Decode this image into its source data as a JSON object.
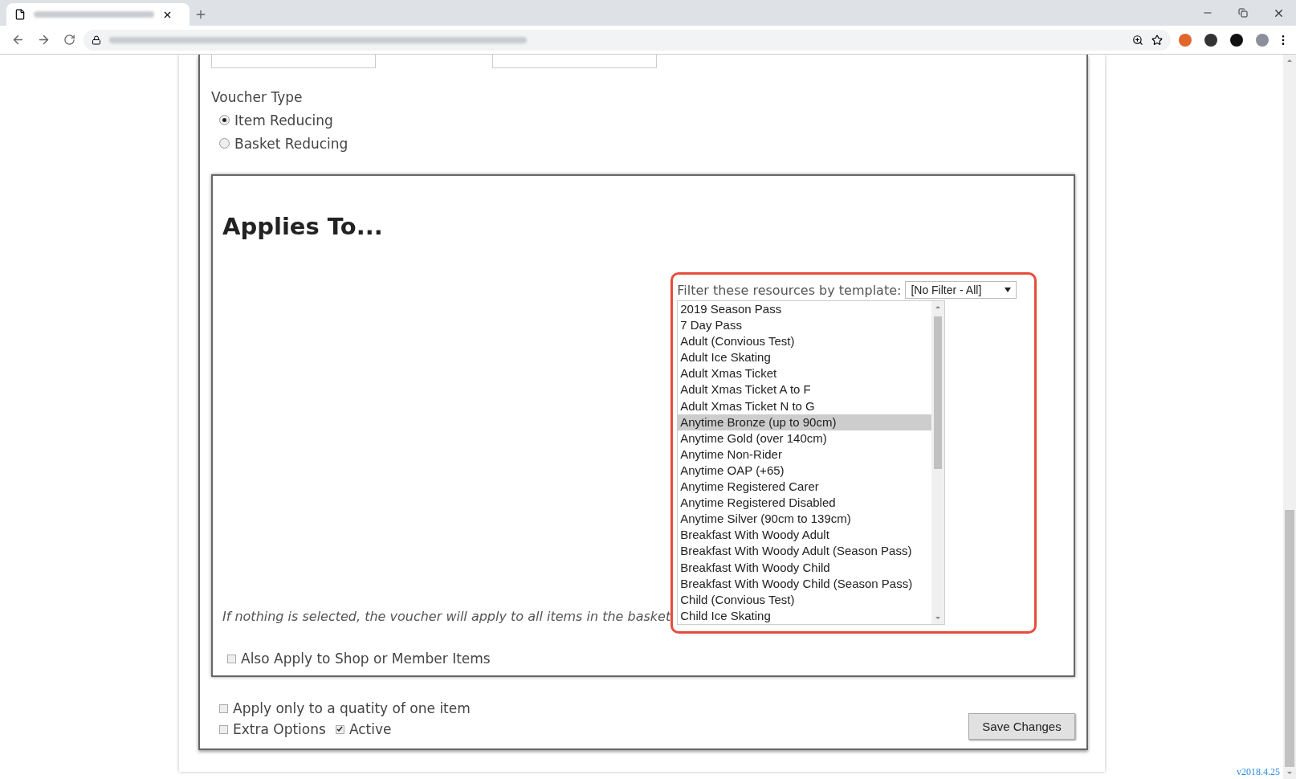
{
  "voucher_type": {
    "label": "Voucher Type",
    "options": [
      {
        "label": "Item Reducing",
        "selected": true
      },
      {
        "label": "Basket Reducing",
        "selected": false
      }
    ]
  },
  "applies_to": {
    "title": "Applies To...",
    "filter": {
      "label": "Filter these resources by template:",
      "value": "[No Filter - All]"
    },
    "resources": [
      {
        "label": "2019 Season Pass",
        "selected": false
      },
      {
        "label": "7 Day Pass",
        "selected": false
      },
      {
        "label": "Adult (Convious Test)",
        "selected": false
      },
      {
        "label": "Adult Ice Skating",
        "selected": false
      },
      {
        "label": "Adult Xmas Ticket",
        "selected": false
      },
      {
        "label": "Adult Xmas Ticket A to F",
        "selected": false
      },
      {
        "label": "Adult Xmas Ticket N to G",
        "selected": false
      },
      {
        "label": "Anytime Bronze (up to 90cm)",
        "selected": true
      },
      {
        "label": "Anytime Gold (over 140cm)",
        "selected": false
      },
      {
        "label": "Anytime Non-Rider",
        "selected": false
      },
      {
        "label": "Anytime OAP (+65)",
        "selected": false
      },
      {
        "label": "Anytime Registered Carer",
        "selected": false
      },
      {
        "label": "Anytime Registered Disabled",
        "selected": false
      },
      {
        "label": "Anytime Silver (90cm to 139cm)",
        "selected": false
      },
      {
        "label": "Breakfast With Woody Adult",
        "selected": false
      },
      {
        "label": "Breakfast With Woody Adult (Season Pass)",
        "selected": false
      },
      {
        "label": "Breakfast With Woody Child",
        "selected": false
      },
      {
        "label": "Breakfast With Woody Child (Season Pass)",
        "selected": false
      },
      {
        "label": "Child (Convious Test)",
        "selected": false
      },
      {
        "label": "Child Ice Skating",
        "selected": false
      }
    ],
    "note": "If nothing is selected, the voucher will apply to all items in the basket",
    "shop_option": {
      "label": "Also Apply to Shop or Member Items",
      "checked": false
    }
  },
  "options": [
    {
      "label": "Apply only to a quatity of one item",
      "checked": false
    }
  ],
  "inline_options": [
    {
      "label": "Extra Options",
      "checked": false
    },
    {
      "label": "Active",
      "checked": true
    }
  ],
  "save_button": "Save Changes",
  "version": "v2018.4.25"
}
